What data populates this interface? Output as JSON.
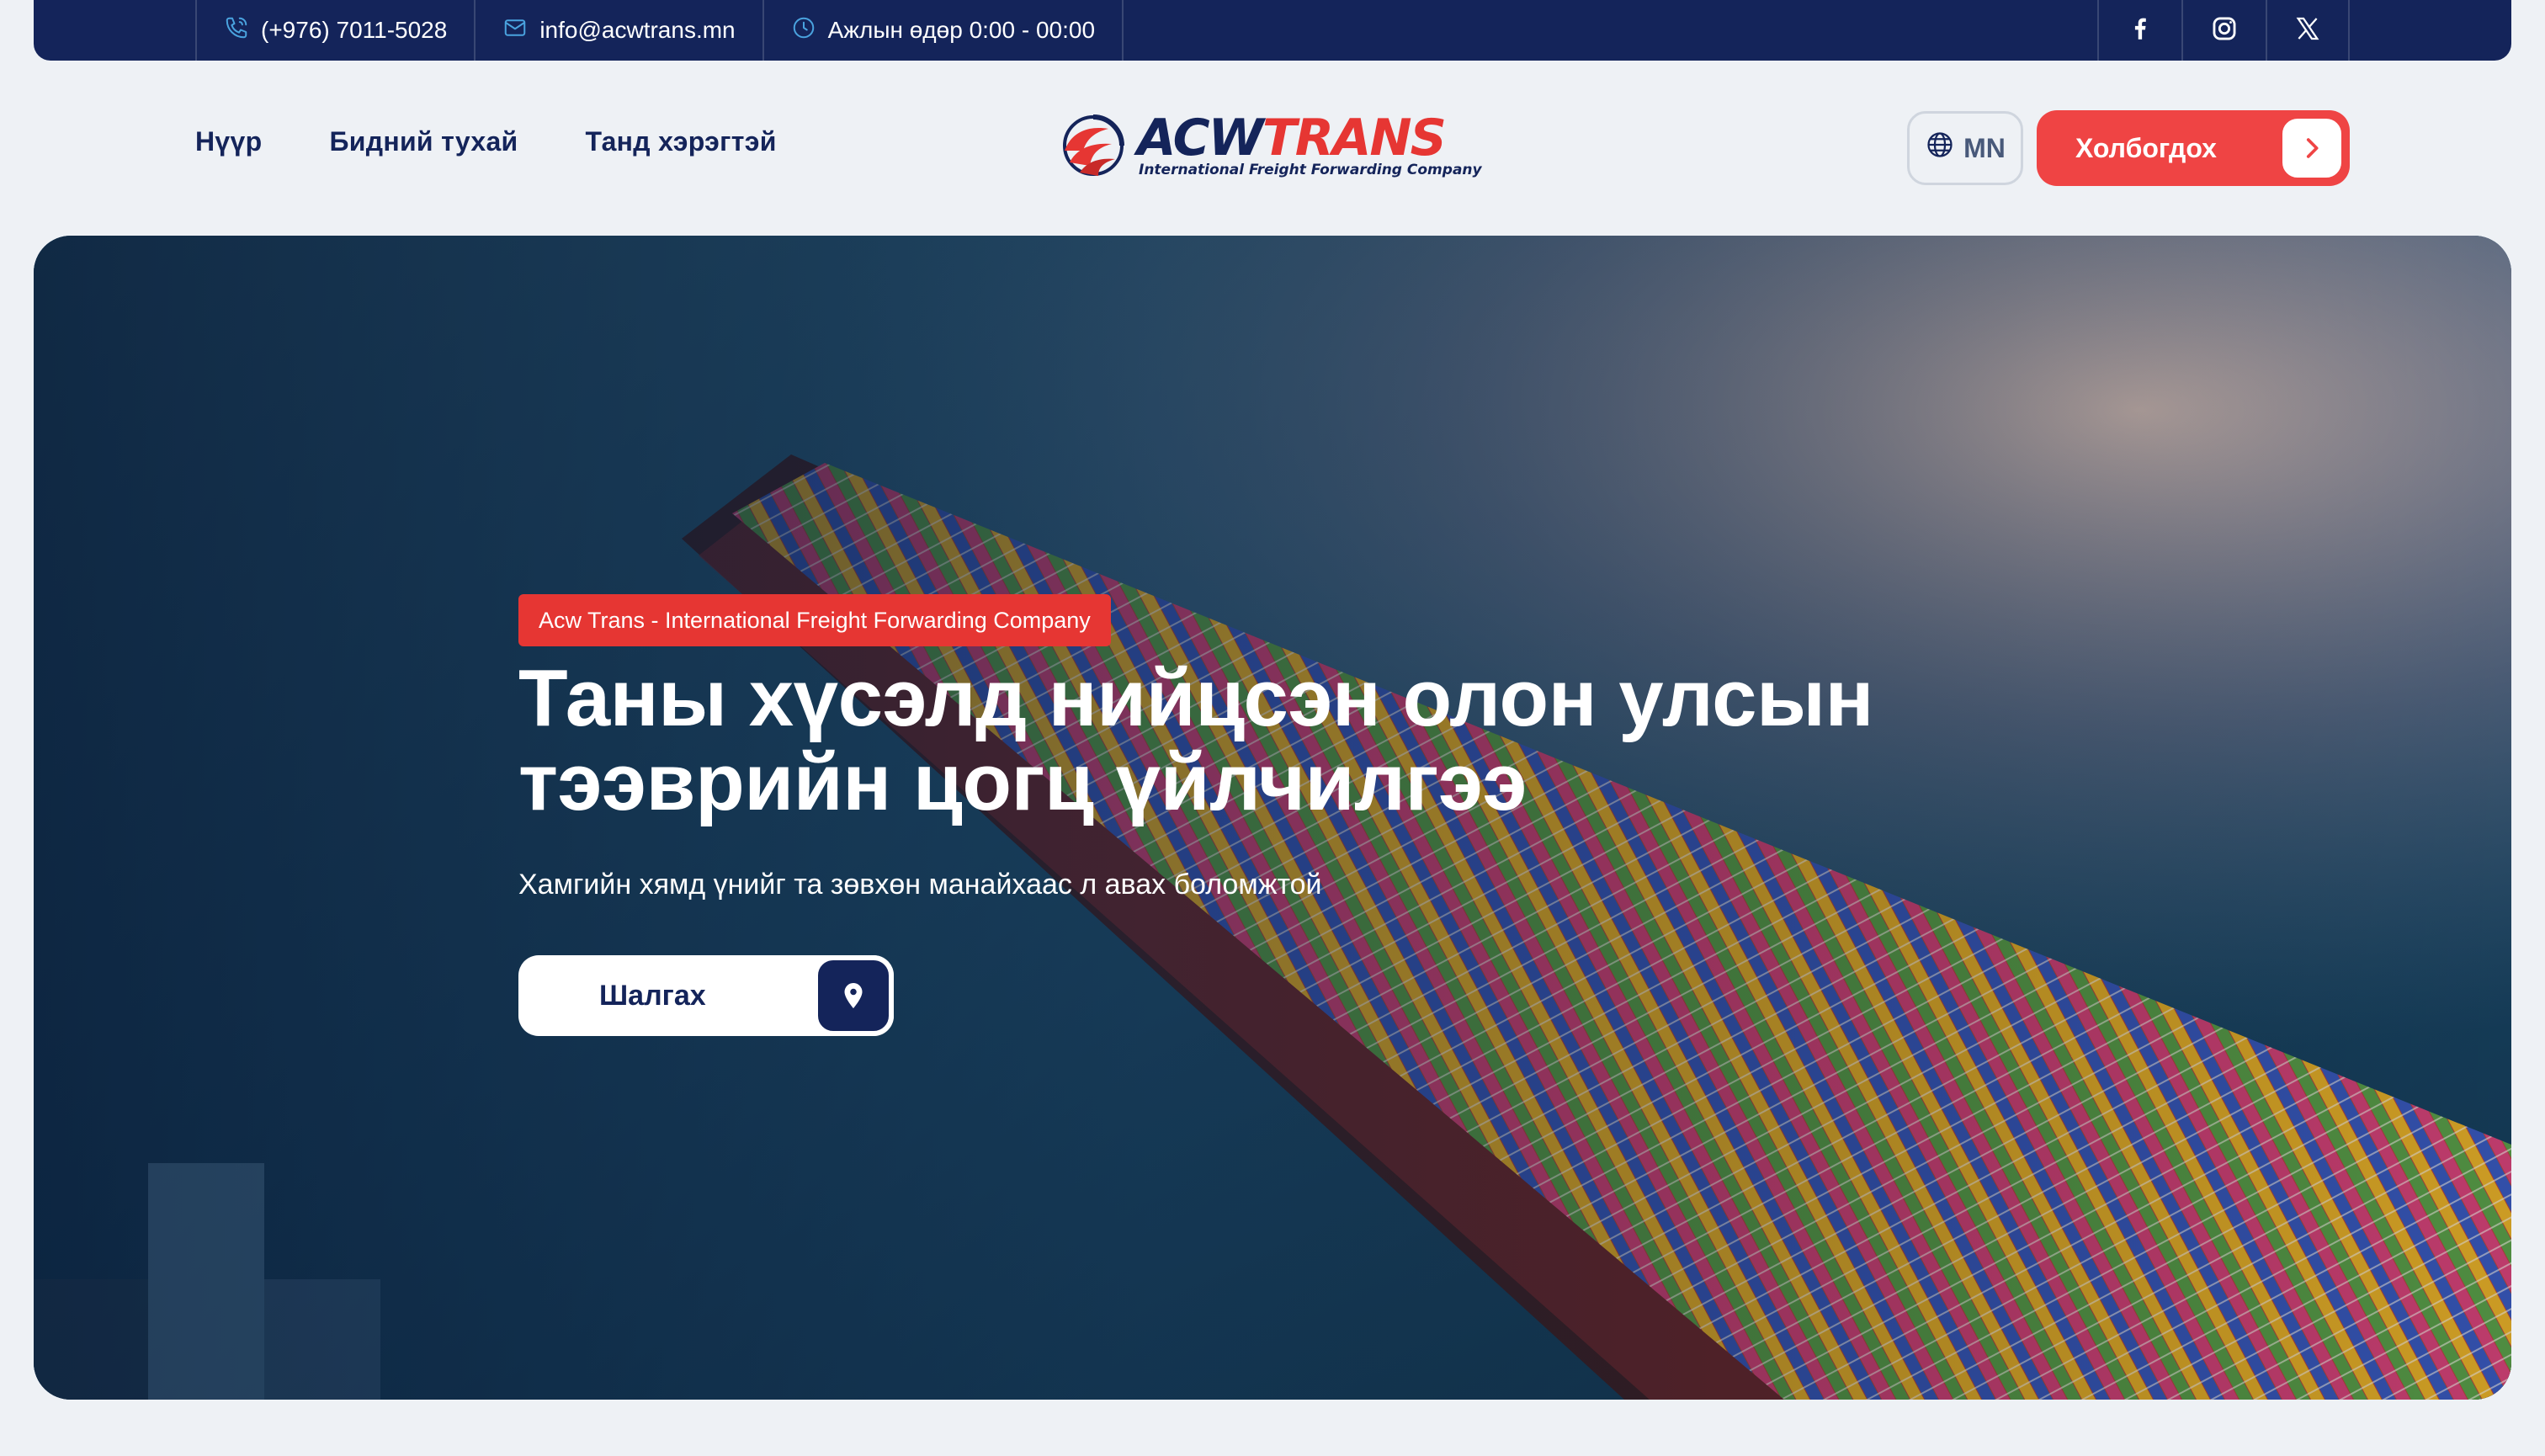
{
  "topbar": {
    "phone": "(+976) 7011-5028",
    "email": "info@acwtrans.mn",
    "hours": "Ажлын өдөр 0:00 - 00:00",
    "socials": [
      "facebook-icon",
      "instagram-icon",
      "x-icon"
    ]
  },
  "nav": {
    "items": [
      {
        "label": "Нүүр"
      },
      {
        "label": "Бидний тухай"
      },
      {
        "label": "Танд хэрэгтэй"
      }
    ]
  },
  "logo": {
    "word_primary": "ACW",
    "word_secondary": "TRANS",
    "tagline": "International Freight Forwarding Company"
  },
  "header": {
    "language": "MN",
    "contact_label": "Холбогдох"
  },
  "hero": {
    "tag": "Acw Trans - International Freight Forwarding Company",
    "title_line1": "Таны хүсэлд нийцсэн олон улсын",
    "title_line2": "тээврийн цогц үйлчилгээ",
    "subtitle": "Хамгийн хямд үнийг та зөвхөн манайхаас л авах боломжтой",
    "search_label": "Шалгах"
  },
  "colors": {
    "navy": "#14245a",
    "accent_red": "#e63633",
    "page_bg": "#eef1f5"
  }
}
